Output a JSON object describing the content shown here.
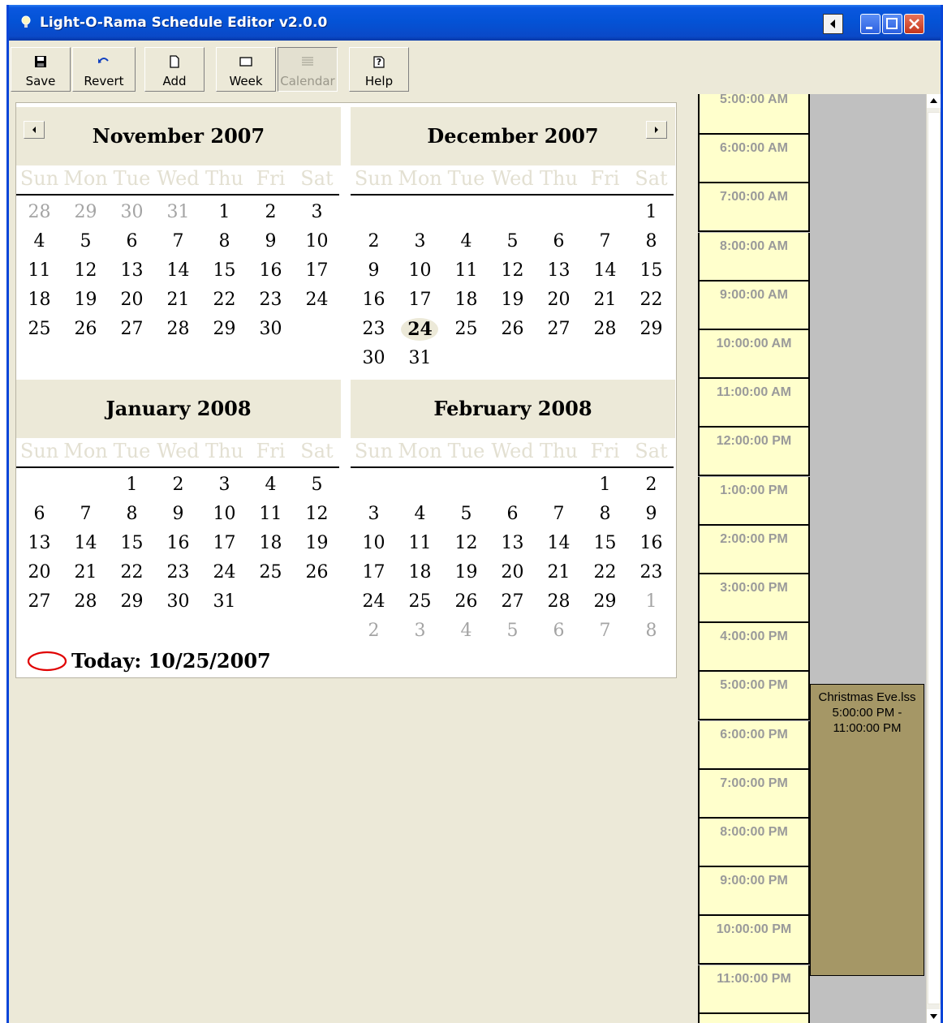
{
  "window": {
    "title": "Light-O-Rama Schedule Editor v2.0.0"
  },
  "toolbar": {
    "buttons": [
      {
        "label": "Save",
        "icon": "floppy-disk-icon"
      },
      {
        "label": "Revert",
        "icon": "undo-icon"
      },
      {
        "label": "Add",
        "icon": "new-page-icon"
      },
      {
        "label": "Week",
        "icon": "window-icon"
      },
      {
        "label": "Calendar",
        "icon": "calendar-list-icon",
        "disabled": true
      },
      {
        "label": "Help",
        "icon": "help-icon"
      }
    ]
  },
  "calendar": {
    "weekdays": [
      "Sun",
      "Mon",
      "Tue",
      "Wed",
      "Thu",
      "Fri",
      "Sat"
    ],
    "months": [
      {
        "title": "November 2007",
        "days": [
          [
            "28",
            "29",
            "30",
            "31",
            "1",
            "2",
            "3"
          ],
          [
            "4",
            "5",
            "6",
            "7",
            "8",
            "9",
            "10"
          ],
          [
            "11",
            "12",
            "13",
            "14",
            "15",
            "16",
            "17"
          ],
          [
            "18",
            "19",
            "20",
            "21",
            "22",
            "23",
            "24"
          ],
          [
            "25",
            "26",
            "27",
            "28",
            "29",
            "30",
            ""
          ]
        ],
        "other_month": [
          [
            0,
            0
          ],
          [
            0,
            1
          ],
          [
            0,
            2
          ],
          [
            0,
            3
          ]
        ]
      },
      {
        "title": "December 2007",
        "days": [
          [
            "",
            "",
            "",
            "",
            "",
            "",
            "1"
          ],
          [
            "2",
            "3",
            "4",
            "5",
            "6",
            "7",
            "8"
          ],
          [
            "9",
            "10",
            "11",
            "12",
            "13",
            "14",
            "15"
          ],
          [
            "16",
            "17",
            "18",
            "19",
            "20",
            "21",
            "22"
          ],
          [
            "23",
            "24",
            "25",
            "26",
            "27",
            "28",
            "29"
          ],
          [
            "30",
            "31",
            "",
            "",
            "",
            "",
            ""
          ]
        ],
        "selected": [
          4,
          1
        ],
        "other_month": []
      },
      {
        "title": "January 2008",
        "days": [
          [
            "",
            "",
            "1",
            "2",
            "3",
            "4",
            "5"
          ],
          [
            "6",
            "7",
            "8",
            "9",
            "10",
            "11",
            "12"
          ],
          [
            "13",
            "14",
            "15",
            "16",
            "17",
            "18",
            "19"
          ],
          [
            "20",
            "21",
            "22",
            "23",
            "24",
            "25",
            "26"
          ],
          [
            "27",
            "28",
            "29",
            "30",
            "31",
            "",
            ""
          ]
        ],
        "other_month": []
      },
      {
        "title": "February 2008",
        "days": [
          [
            "",
            "",
            "",
            "",
            "",
            "1",
            "2"
          ],
          [
            "3",
            "4",
            "5",
            "6",
            "7",
            "8",
            "9"
          ],
          [
            "10",
            "11",
            "12",
            "13",
            "14",
            "15",
            "16"
          ],
          [
            "17",
            "18",
            "19",
            "20",
            "21",
            "22",
            "23"
          ],
          [
            "24",
            "25",
            "26",
            "27",
            "28",
            "29",
            "1"
          ],
          [
            "2",
            "3",
            "4",
            "5",
            "6",
            "7",
            "8"
          ]
        ],
        "other_month": [
          [
            4,
            6
          ],
          [
            5,
            0
          ],
          [
            5,
            1
          ],
          [
            5,
            2
          ],
          [
            5,
            3
          ],
          [
            5,
            4
          ],
          [
            5,
            5
          ],
          [
            5,
            6
          ]
        ]
      }
    ],
    "today_label": "Today: 10/25/2007"
  },
  "day_view": {
    "hours": [
      "5:00:00 AM",
      "6:00:00 AM",
      "7:00:00 AM",
      "8:00:00 AM",
      "9:00:00 AM",
      "10:00:00 AM",
      "11:00:00 AM",
      "12:00:00 PM",
      "1:00:00 PM",
      "2:00:00 PM",
      "3:00:00 PM",
      "4:00:00 PM",
      "5:00:00 PM",
      "6:00:00 PM",
      "7:00:00 PM",
      "8:00:00 PM",
      "9:00:00 PM",
      "10:00:00 PM",
      "11:00:00 PM"
    ],
    "event": {
      "name": "Christmas Eve.lss",
      "time_start": "5:00:00 PM -",
      "time_end": "11:00:00 PM"
    }
  },
  "colors": {
    "title_bar": "#0453d6",
    "window_bg": "#ece9d8",
    "hour_cell": "#ffffcc",
    "event_fill": "#a59766",
    "today_ring": "#e00000"
  }
}
